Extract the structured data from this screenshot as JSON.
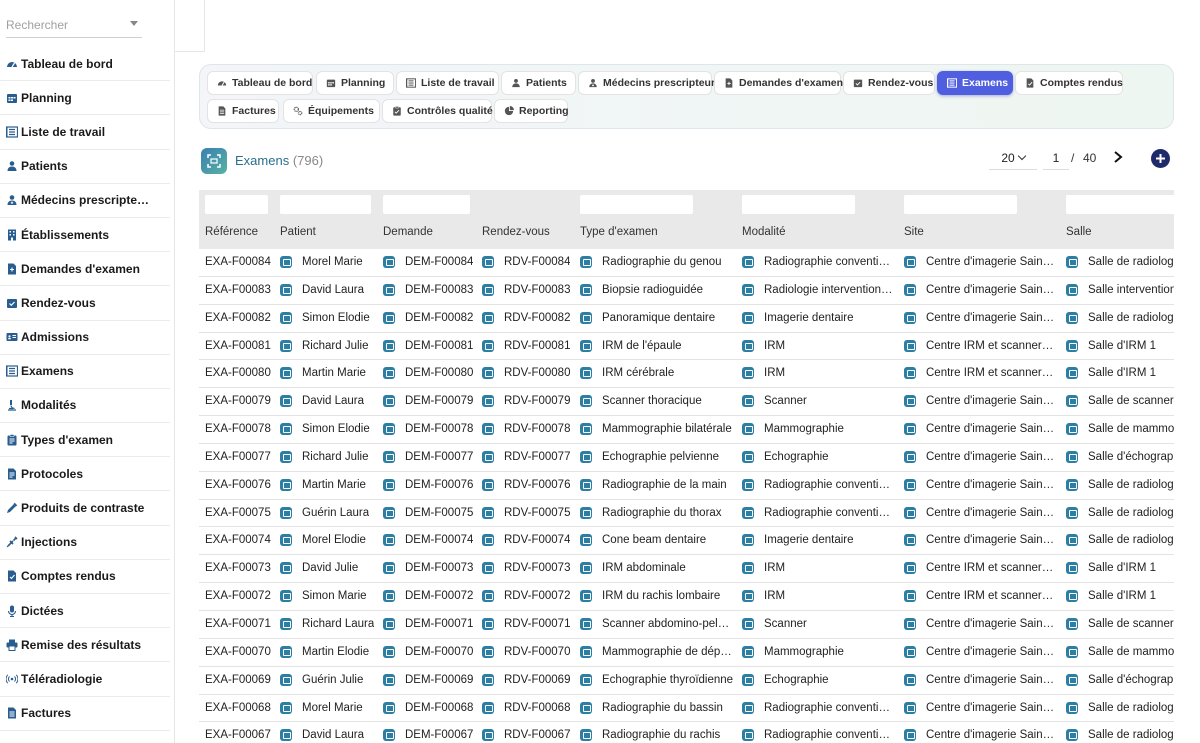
{
  "search": {
    "placeholder": "Rechercher"
  },
  "sidebar": {
    "items": [
      {
        "label": "Tableau de bord",
        "icon": "gauge-icon"
      },
      {
        "label": "Planning",
        "icon": "calendar-icon"
      },
      {
        "label": "Liste de travail",
        "icon": "worklist-icon"
      },
      {
        "label": "Patients",
        "icon": "user-icon"
      },
      {
        "label": "Médecins prescripte…",
        "icon": "doctor-icon"
      },
      {
        "label": "Établissements",
        "icon": "building-icon"
      },
      {
        "label": "Demandes d'examen",
        "icon": "file-request-icon"
      },
      {
        "label": "Rendez-vous",
        "icon": "calendar-check-icon"
      },
      {
        "label": "Admissions",
        "icon": "id-card-icon"
      },
      {
        "label": "Examens",
        "icon": "exam-icon"
      },
      {
        "label": "Modalités",
        "icon": "microscope-icon"
      },
      {
        "label": "Types d'examen",
        "icon": "clipboard-icon"
      },
      {
        "label": "Protocoles",
        "icon": "protocol-icon"
      },
      {
        "label": "Produits de contraste",
        "icon": "eyedropper-icon"
      },
      {
        "label": "Injections",
        "icon": "syringe-icon"
      },
      {
        "label": "Comptes rendus",
        "icon": "report-icon"
      },
      {
        "label": "Dictées",
        "icon": "microphone-icon"
      },
      {
        "label": "Remise des résultats",
        "icon": "printer-icon"
      },
      {
        "label": "Téléradiologie",
        "icon": "broadcast-icon"
      },
      {
        "label": "Factures",
        "icon": "invoice-icon"
      }
    ]
  },
  "tabs": [
    {
      "label": "Tableau de bord",
      "icon": "gauge-icon",
      "active": false
    },
    {
      "label": "Planning",
      "icon": "calendar-icon",
      "active": false
    },
    {
      "label": "Liste de travail",
      "icon": "worklist-icon",
      "active": false
    },
    {
      "label": "Patients",
      "icon": "user-icon",
      "active": false
    },
    {
      "label": "Médecins prescripteurs",
      "icon": "doctor-icon",
      "active": false
    },
    {
      "label": "Demandes d'examen",
      "icon": "file-request-icon",
      "active": false
    },
    {
      "label": "Rendez-vous",
      "icon": "calendar-check-icon",
      "active": false
    },
    {
      "label": "Examens",
      "icon": "exam-icon",
      "active": true
    },
    {
      "label": "Comptes rendus",
      "icon": "report-icon",
      "active": false
    },
    {
      "label": "Factures",
      "icon": "invoice-icon",
      "active": false
    },
    {
      "label": "Équipements",
      "icon": "gears-icon",
      "active": false
    },
    {
      "label": "Contrôles qualité",
      "icon": "clipboard-check-icon",
      "active": false
    },
    {
      "label": "Reporting",
      "icon": "pie-chart-icon",
      "active": false
    }
  ],
  "header": {
    "title": "Examens",
    "count": "(796)"
  },
  "pager": {
    "page_size": "20",
    "page": "1",
    "separator": "/",
    "total_pages": "40"
  },
  "table": {
    "columns": [
      "Référence",
      "Patient",
      "Demande",
      "Rendez-vous",
      "Type d'examen",
      "Modalité",
      "Site",
      "Salle"
    ],
    "rows": [
      [
        "EXA-F00084",
        "Morel Marie",
        "DEM-F00084",
        "RDV-F00084",
        "Radiographie du genou",
        "Radiographie conventio…",
        "Centre d'imagerie Saint…",
        "Salle de radiologie"
      ],
      [
        "EXA-F00083",
        "David Laura",
        "DEM-F00083",
        "RDV-F00083",
        "Biopsie radioguidée",
        "Radiologie intervention…",
        "Centre d'imagerie Saint…",
        "Salle interventionnelle"
      ],
      [
        "EXA-F00082",
        "Simon Élodie",
        "DEM-F00082",
        "RDV-F00082",
        "Panoramique dentaire",
        "Imagerie dentaire",
        "Centre d'imagerie Saint…",
        "Salle de radiologie"
      ],
      [
        "EXA-F00081",
        "Richard Julie",
        "DEM-F00081",
        "RDV-F00081",
        "IRM de l'épaule",
        "IRM",
        "Centre IRM et scanner …",
        "Salle d'IRM 1"
      ],
      [
        "EXA-F00080",
        "Martin Marie",
        "DEM-F00080",
        "RDV-F00080",
        "IRM cérébrale",
        "IRM",
        "Centre IRM et scanner …",
        "Salle d'IRM 1"
      ],
      [
        "EXA-F00079",
        "David Laura",
        "DEM-F00079",
        "RDV-F00079",
        "Scanner thoracique",
        "Scanner",
        "Centre d'imagerie Saint…",
        "Salle de scanner"
      ],
      [
        "EXA-F00078",
        "Simon Élodie",
        "DEM-F00078",
        "RDV-F00078",
        "Mammographie bilatérale",
        "Mammographie",
        "Centre d'imagerie Saint…",
        "Salle de mammographie"
      ],
      [
        "EXA-F00077",
        "Richard Julie",
        "DEM-F00077",
        "RDV-F00077",
        "Échographie pelvienne",
        "Échographie",
        "Centre d'imagerie Saint…",
        "Salle d'échographie"
      ],
      [
        "EXA-F00076",
        "Martin Marie",
        "DEM-F00076",
        "RDV-F00076",
        "Radiographie de la main",
        "Radiographie conventio…",
        "Centre d'imagerie Saint…",
        "Salle de radiologie"
      ],
      [
        "EXA-F00075",
        "Guérin Laura",
        "DEM-F00075",
        "RDV-F00075",
        "Radiographie du thorax",
        "Radiographie conventio…",
        "Centre d'imagerie Saint…",
        "Salle de radiologie"
      ],
      [
        "EXA-F00074",
        "Morel Élodie",
        "DEM-F00074",
        "RDV-F00074",
        "Cone beam dentaire",
        "Imagerie dentaire",
        "Centre d'imagerie Saint…",
        "Salle de radiologie"
      ],
      [
        "EXA-F00073",
        "David Julie",
        "DEM-F00073",
        "RDV-F00073",
        "IRM abdominale",
        "IRM",
        "Centre IRM et scanner …",
        "Salle d'IRM 1"
      ],
      [
        "EXA-F00072",
        "Simon Marie",
        "DEM-F00072",
        "RDV-F00072",
        "IRM du rachis lombaire",
        "IRM",
        "Centre IRM et scanner …",
        "Salle d'IRM 1"
      ],
      [
        "EXA-F00071",
        "Richard Laura",
        "DEM-F00071",
        "RDV-F00071",
        "Scanner abdomino-pelv…",
        "Scanner",
        "Centre d'imagerie Saint…",
        "Salle de scanner"
      ],
      [
        "EXA-F00070",
        "Martin Élodie",
        "DEM-F00070",
        "RDV-F00070",
        "Mammographie de dépi…",
        "Mammographie",
        "Centre d'imagerie Saint…",
        "Salle de mammographie"
      ],
      [
        "EXA-F00069",
        "Guérin Julie",
        "DEM-F00069",
        "RDV-F00069",
        "Échographie thyroïdienne",
        "Échographie",
        "Centre d'imagerie Saint…",
        "Salle d'échographie"
      ],
      [
        "EXA-F00068",
        "Morel Marie",
        "DEM-F00068",
        "RDV-F00068",
        "Radiographie du bassin",
        "Radiographie conventio…",
        "Centre d'imagerie Saint…",
        "Salle de radiologie"
      ],
      [
        "EXA-F00067",
        "David Laura",
        "DEM-F00067",
        "RDV-F00067",
        "Radiographie du rachis",
        "Radiographie conventio…",
        "Centre d'imagerie Saint…",
        "Salle de radiologie"
      ]
    ]
  }
}
